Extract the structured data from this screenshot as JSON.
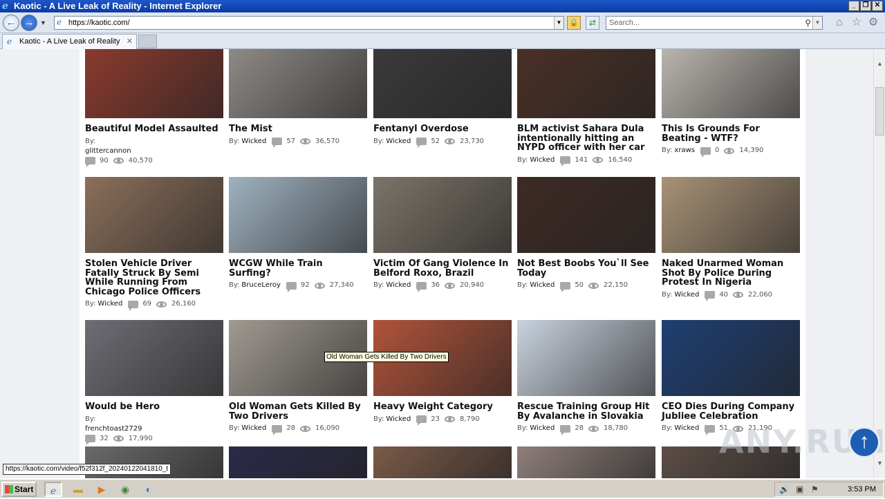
{
  "window": {
    "title": "Kaotic - A Live Leak of Reality - Internet Explorer",
    "controls": [
      "_",
      "❐",
      "✕"
    ]
  },
  "address_bar": {
    "url": "https://kaotic.com/",
    "search_placeholder": "Search..."
  },
  "tabs": [
    {
      "label": "Kaotic - A Live Leak of Reality"
    }
  ],
  "videos": [
    {
      "title": "Beautiful Model Assaulted",
      "by": "By:",
      "author": "glittercannon",
      "comments": "90",
      "views": "40,570",
      "thumb_color": "#8a3a2e"
    },
    {
      "title": "The Mist",
      "by": "By:",
      "author": "Wicked",
      "comments": "57",
      "views": "36,570",
      "thumb_color": "#8e8a86"
    },
    {
      "title": "Fentanyl Overdose",
      "by": "By:",
      "author": "Wicked",
      "comments": "52",
      "views": "23,730",
      "thumb_color": "#3a3a3a"
    },
    {
      "title": "BLM activist Sahara Dula intentionally hitting an NYPD officer with her car",
      "by": "By:",
      "author": "Wicked",
      "comments": "141",
      "views": "16,540",
      "thumb_color": "#4a3026"
    },
    {
      "title": "This Is Grounds For Beating - WTF?",
      "by": "By:",
      "author": "xraws",
      "comments": "0",
      "views": "14,390",
      "thumb_color": "#b9b4ae"
    },
    {
      "title": "Stolen Vehicle Driver Fatally Struck By Semi While Running From Chicago Police Officers",
      "by": "By:",
      "author": "Wicked",
      "comments": "69",
      "views": "26,160",
      "thumb_color": "#8b6f5a"
    },
    {
      "title": "WCGW While Train Surfing?",
      "by": "By:",
      "author": "BruceLeroy",
      "comments": "92",
      "views": "27,340",
      "thumb_color": "#9fb2c0"
    },
    {
      "title": "Victim Of Gang Violence In Belford Roxo, Brazil",
      "by": "By:",
      "author": "Wicked",
      "comments": "36",
      "views": "20,940",
      "thumb_color": "#7c7468"
    },
    {
      "title": "Not Best Boobs You`ll See Today",
      "by": "By:",
      "author": "Wicked",
      "comments": "50",
      "views": "22,150",
      "thumb_color": "#3e2a24"
    },
    {
      "title": "Naked Unarmed Woman Shot By Police During Protest In Nigeria",
      "by": "By:",
      "author": "Wicked",
      "comments": "40",
      "views": "22,060",
      "thumb_color": "#a89276"
    },
    {
      "title": "Would be Hero",
      "by": "By:",
      "author": "frenchtoast2729",
      "comments": "32",
      "views": "17,990",
      "thumb_color": "#6d6e74"
    },
    {
      "title": "Old Woman Gets Killed By Two Drivers",
      "by": "By:",
      "author": "Wicked",
      "comments": "28",
      "views": "16,090",
      "thumb_color": "#a19a92"
    },
    {
      "title": "Heavy Weight Category",
      "by": "By:",
      "author": "Wicked",
      "comments": "23",
      "views": "8,790",
      "thumb_color": "#b0533a"
    },
    {
      "title": "Rescue Training Group Hit By Avalanche in Slovakia",
      "by": "By:",
      "author": "Wicked",
      "comments": "28",
      "views": "18,780",
      "thumb_color": "#c9d2de"
    },
    {
      "title": "CEO Dies During Company Jubliee Celebration",
      "by": "By:",
      "author": "Wicked",
      "comments": "51",
      "views": "21,190",
      "thumb_color": "#1f3f73"
    },
    {
      "title": "",
      "thumb_color": "#6b6a6a"
    },
    {
      "title": "",
      "thumb_color": "#2a2a4a"
    },
    {
      "title": "",
      "thumb_color": "#7a5a48"
    },
    {
      "title": "",
      "thumb_color": "#8f7f7a"
    },
    {
      "title": "",
      "thumb_color": "#5c4d46"
    }
  ],
  "tooltip": "Old Woman Gets Killed By Two Drivers",
  "status_url": "https://kaotic.com/video/f52f312f_20240122041810_t",
  "watermark": "ANY.RUN",
  "taskbar": {
    "start_label": "Start",
    "clock": "3:53 PM"
  }
}
